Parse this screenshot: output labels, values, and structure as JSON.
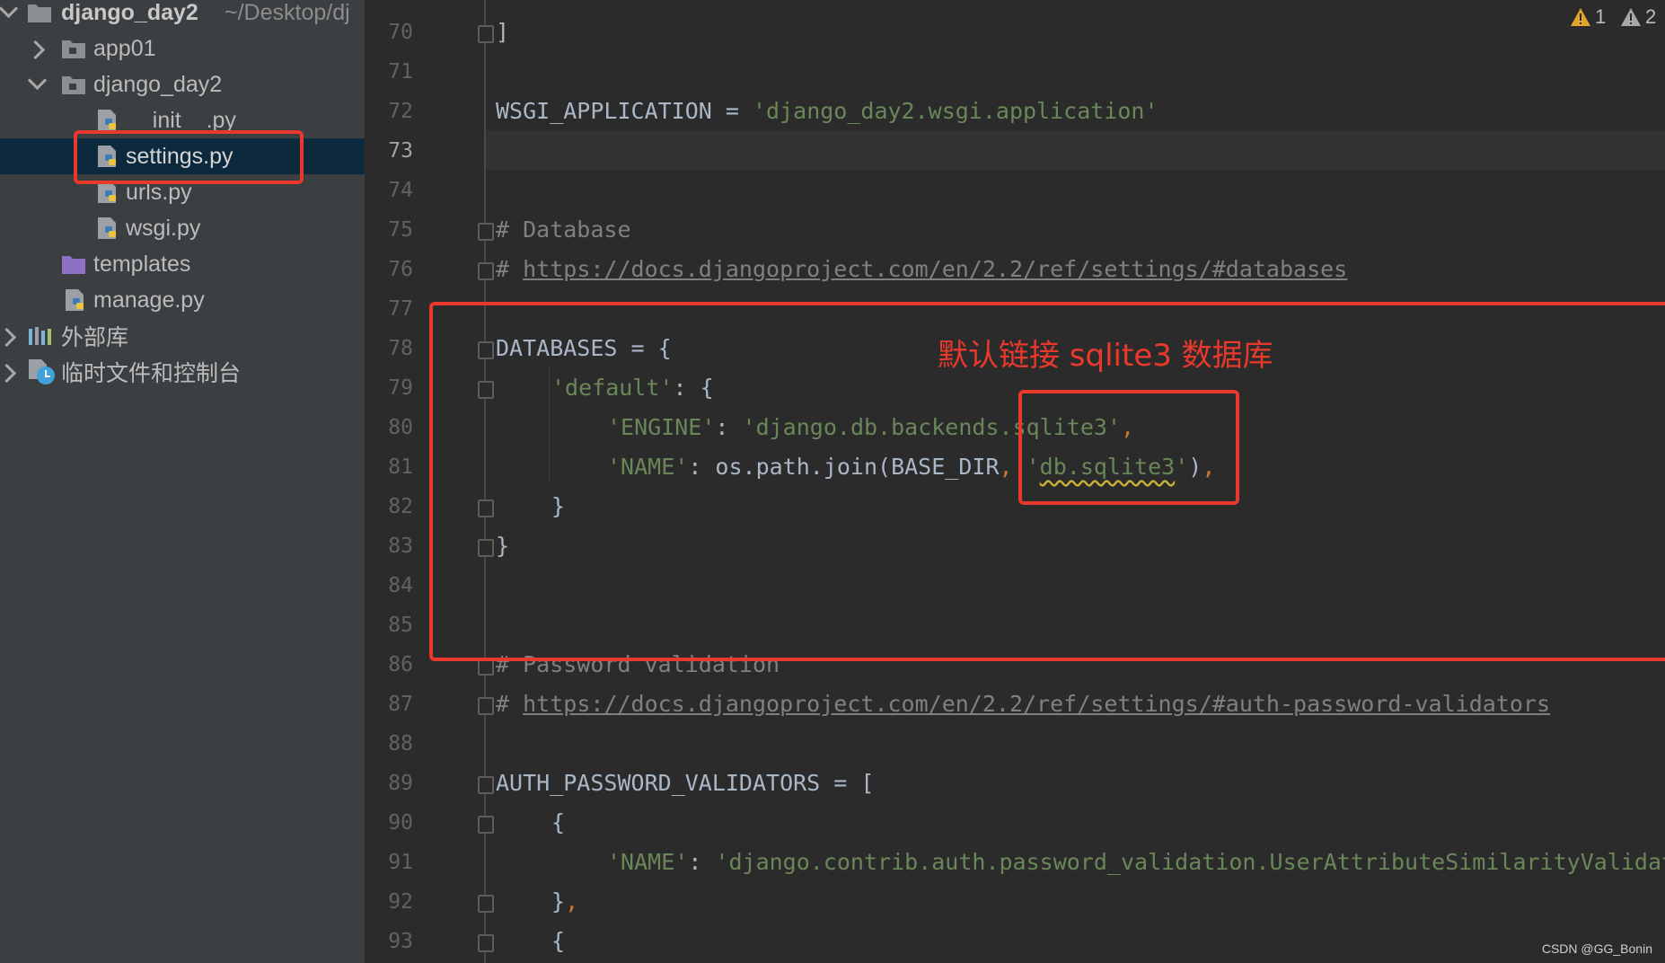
{
  "sidebar": {
    "project_name": "django_day2",
    "project_path": "~/Desktop/dj",
    "items": [
      {
        "label": "app01"
      },
      {
        "label": "django_day2"
      },
      {
        "label": "__init__.py"
      },
      {
        "label": "settings.py"
      },
      {
        "label": "urls.py"
      },
      {
        "label": "wsgi.py"
      },
      {
        "label": "templates"
      },
      {
        "label": "manage.py"
      },
      {
        "label": "外部库"
      },
      {
        "label": "临时文件和控制台"
      }
    ]
  },
  "editor": {
    "current_line": "73",
    "lines": [
      {
        "n": "70"
      },
      {
        "n": "71"
      },
      {
        "n": "72"
      },
      {
        "n": "73"
      },
      {
        "n": "74"
      },
      {
        "n": "75"
      },
      {
        "n": "76"
      },
      {
        "n": "77"
      },
      {
        "n": "78"
      },
      {
        "n": "79"
      },
      {
        "n": "80"
      },
      {
        "n": "81"
      },
      {
        "n": "82"
      },
      {
        "n": "83"
      },
      {
        "n": "84"
      },
      {
        "n": "85"
      },
      {
        "n": "86"
      },
      {
        "n": "87"
      },
      {
        "n": "88"
      },
      {
        "n": "89"
      },
      {
        "n": "90"
      },
      {
        "n": "91"
      },
      {
        "n": "92"
      },
      {
        "n": "93"
      }
    ],
    "code": {
      "l70": "]",
      "l72_name": "WSGI_APPLICATION = ",
      "l72_str": "'django_day2.wsgi.application'",
      "l75": "# Database",
      "l76_hash": "# ",
      "l76_link": "https://docs.djangoproject.com/en/2.2/ref/settings/#databases",
      "l78": "DATABASES = {",
      "l79_str": "'default'",
      "l79_rest": ": {",
      "l80_key": "'ENGINE'",
      "l80_colon": ": ",
      "l80_str1": "'django.db.backends",
      "l80_str2": ".sqlite3'",
      "l80_comma": ",",
      "l81_key": "'NAME'",
      "l81_mid": ": os.path.join(BASE_DIR",
      "l81_comma1": ", ",
      "l81_q1": "'",
      "l81_str": "db.sqlite3",
      "l81_q2": "'",
      "l81_paren": ")",
      "l81_comma2": ",",
      "l82": "}",
      "l83": "}",
      "l86": "# Password validation",
      "l87_hash": "# ",
      "l87_link": "https://docs.djangoproject.com/en/2.2/ref/settings/#auth-password-validators",
      "l89": "AUTH_PASSWORD_VALIDATORS = [",
      "l90": "{",
      "l91_key": "'NAME'",
      "l91_colon": ": ",
      "l91_str": "'django.contrib.auth.password_validation.UserAttributeSimilarityValidator'",
      "l92": "}",
      "l92_comma": ",",
      "l93": "{"
    },
    "warnings": {
      "count1": "1",
      "count2": "2"
    }
  },
  "annotation": {
    "text": "默认链接 sqlite3 数据库"
  },
  "watermark": "CSDN @GG_Bonin",
  "colors": {
    "annotation_red": "#e8392c",
    "string_green": "#6a8759",
    "keyword_orange": "#cc7832",
    "comment_gray": "#808080"
  }
}
